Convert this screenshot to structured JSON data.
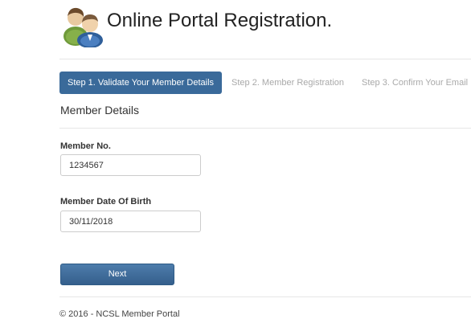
{
  "header": {
    "title": "Online Portal Registration.",
    "logo_icon": "users-icon"
  },
  "steps": [
    {
      "label": "Step 1. Validate Your Member Details",
      "active": true
    },
    {
      "label": "Step 2. Member Registration",
      "active": false
    },
    {
      "label": "Step 3. Confirm Your Email",
      "active": false
    }
  ],
  "form": {
    "section_title": "Member Details",
    "member_no": {
      "label": "Member No.",
      "value": "1234567"
    },
    "dob": {
      "label": "Member Date Of Birth",
      "value": "30/11/2018"
    },
    "next_label": "Next"
  },
  "footer": {
    "text": "© 2016 - NCSL Member Portal"
  },
  "colors": {
    "accent": "#3a6a9a",
    "inactive_step": "#a9a9a9"
  }
}
